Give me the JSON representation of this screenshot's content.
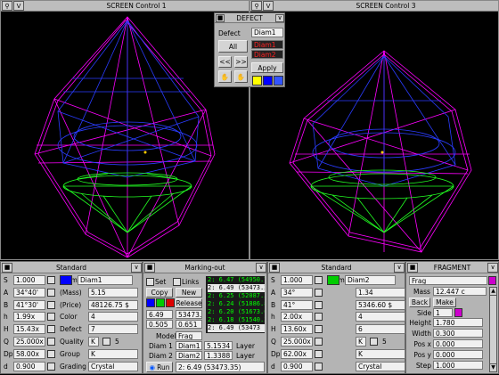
{
  "colors": {
    "wire_magenta": "#ff00ff",
    "wire_blue": "#2a3cff",
    "wire_green": "#22ff22",
    "panel_gray": "#b4b4b4",
    "swatch_blue": "#0000ff",
    "swatch_green": "#00cc00",
    "swatch_red": "#dd0000",
    "swatch_yellow": "#ffff00",
    "swatch_magenta": "#cc00cc"
  },
  "screen1": {
    "title": "SCREEN Control 1",
    "menu_glyph": "V"
  },
  "screen3": {
    "title": "SCREEN Control 3",
    "menu_glyph": "V"
  },
  "defect": {
    "title": "DEFECT",
    "col_defect": "Defect",
    "col_diam": "Diam1",
    "all_label": "All",
    "red_items": [
      "Diam1",
      "Diam2"
    ],
    "prev_label": "<<",
    "next_label": ">>",
    "apply_label": "Apply"
  },
  "std1": {
    "title": "Standard",
    "rows": [
      {
        "key": "S",
        "value": "1.000"
      },
      {
        "key": "A",
        "value": "34°40'"
      },
      {
        "key": "B",
        "value": "41°30'"
      },
      {
        "key": "h",
        "value": "1.99x"
      },
      {
        "key": "H",
        "value": "15.43x"
      },
      {
        "key": "Q",
        "value": "25.000x"
      },
      {
        "key": "Dp",
        "value": "58.00x"
      },
      {
        "key": "d",
        "value": "0.900"
      }
    ],
    "right_rows": [
      {
        "label": "Diam1",
        "value": ""
      },
      {
        "label": "(Mass)",
        "value": "5.15"
      },
      {
        "label": "(Price)",
        "value": "48126.75 $"
      },
      {
        "label": "Color",
        "value": "4"
      },
      {
        "label": "Defect",
        "value": "7"
      },
      {
        "label": "Quality",
        "value": "K",
        "extra": "5"
      },
      {
        "label": "Group",
        "value": "K"
      },
      {
        "label": "Grading",
        "value": "Crystal"
      }
    ]
  },
  "marking": {
    "title": "Marking-out",
    "set_label": "Set",
    "links_label": "Links",
    "copy_label": "Copy",
    "new_label": "New",
    "release_label": "Release",
    "values": [
      "6.49",
      "53473.3",
      "0.505",
      "0.651"
    ],
    "model_label": "Model",
    "model_value": "Frag",
    "diam1_label": "Diam 1",
    "diam1_value": "Diam1",
    "diam1_num": "5.1534",
    "diam1_layer": "Layer",
    "diam2_label": "Diam 2",
    "diam2_value": "Diam2",
    "diam2_num": "1.3388",
    "diam2_layer": "Layer",
    "list": [
      "2: 6.47 (54950.7",
      "2: 6.49 (53473.3",
      "2: 6.25 (52087.3",
      "2: 6.24 (51886.8",
      "2: 6.20 (51673.6",
      "2: 6.18 (51540.3",
      "2: 6.49 (53473"
    ],
    "run_label": "Run",
    "status": "2: 6.49 (53473.35)"
  },
  "std2": {
    "title": "Standard",
    "rows": [
      {
        "key": "S",
        "value": "1.000"
      },
      {
        "key": "A",
        "value": "34°"
      },
      {
        "key": "B",
        "value": "41°"
      },
      {
        "key": "h",
        "value": "2.00x"
      },
      {
        "key": "H",
        "value": "13.60x"
      },
      {
        "key": "Q",
        "value": "25.000x"
      },
      {
        "key": "Dp",
        "value": "62.00x"
      },
      {
        "key": "d",
        "value": "0.900"
      }
    ],
    "right_rows": [
      {
        "label": "Diam2",
        "value": ""
      },
      {
        "label": "",
        "value": "1.34"
      },
      {
        "label": "",
        "value": "5346.60 $"
      },
      {
        "label": "",
        "value": "4"
      },
      {
        "label": "",
        "value": "6"
      },
      {
        "label": "",
        "value": "K",
        "extra": "5"
      },
      {
        "label": "",
        "value": "K"
      },
      {
        "label": "",
        "value": "Crystal"
      }
    ]
  },
  "fragment": {
    "title": "FRAGMENT",
    "frag_label": "Frag",
    "mass_label": "Mass",
    "mass_value": "12.447 c",
    "back_label": "Back",
    "make_label": "Make",
    "side_label": "Side",
    "side_value": "1",
    "rows": [
      {
        "label": "Height",
        "value": "1.780"
      },
      {
        "label": "Width",
        "value": "0.300"
      },
      {
        "label": "Pos x",
        "value": "0.000"
      },
      {
        "label": "Pos y",
        "value": "0.000"
      },
      {
        "label": "Step",
        "value": "1.000"
      }
    ]
  }
}
